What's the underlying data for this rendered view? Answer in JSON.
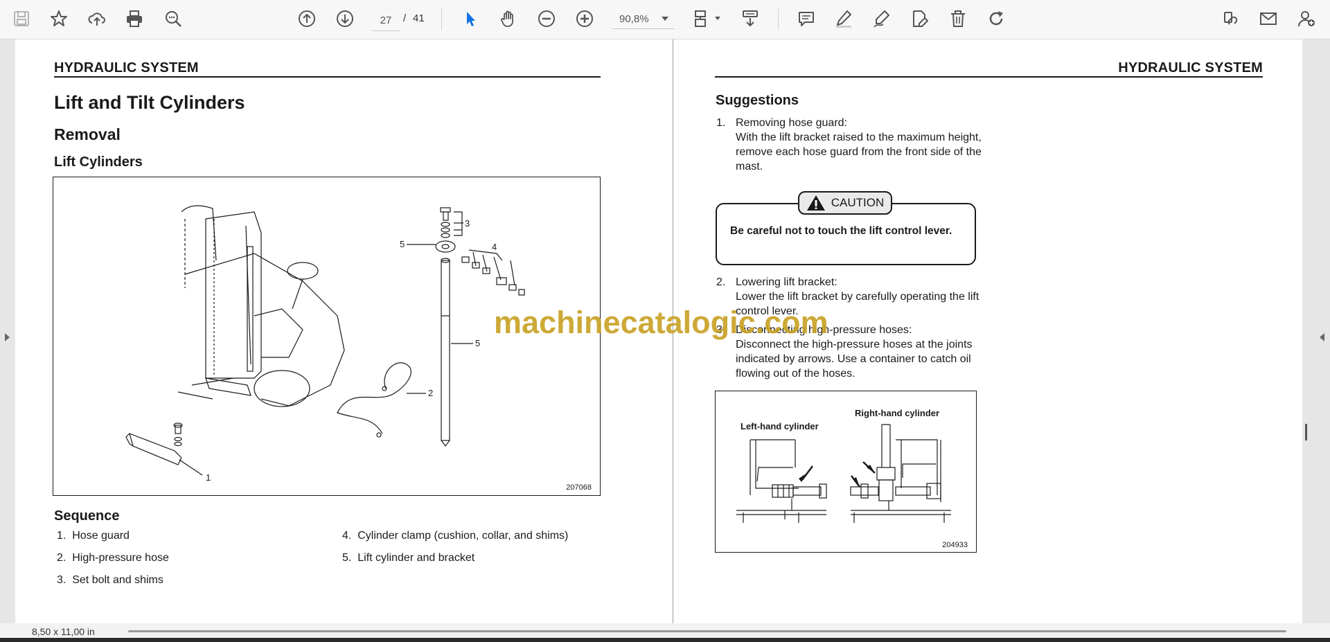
{
  "toolbar": {
    "page_current": "27",
    "page_separator": "/",
    "page_total": "41",
    "zoom_value": "90,8%"
  },
  "left_page": {
    "header": "HYDRAULIC SYSTEM",
    "title": "Lift and Tilt Cylinders",
    "subtitle": "Removal",
    "section": "Lift Cylinders",
    "figure": {
      "id": "207068",
      "callouts": [
        "1",
        "2",
        "3",
        "4",
        "5",
        "5"
      ]
    },
    "sequence_title": "Sequence",
    "sequence": [
      {
        "n": "1.",
        "text": "Hose guard"
      },
      {
        "n": "2.",
        "text": "High-pressure hose"
      },
      {
        "n": "3.",
        "text": "Set bolt and shims"
      },
      {
        "n": "4.",
        "text": "Cylinder clamp (cushion, collar, and shims)"
      },
      {
        "n": "5.",
        "text": "Lift cylinder and bracket"
      }
    ]
  },
  "right_page": {
    "header": "HYDRAULIC SYSTEM",
    "suggestions_title": "Suggestions",
    "steps": [
      {
        "n": "1.",
        "title": "Removing hose guard:",
        "text": "With the lift bracket raised to the maximum height, remove each hose guard from the front side of the mast."
      },
      {
        "n": "2.",
        "title": "Lowering lift bracket:",
        "text": "Lower the lift bracket by carefully operating the lift control lever."
      },
      {
        "n": "3.",
        "title": "Disconnecting high-pressure hoses:",
        "text": "Disconnect the high-pressure hoses at the joints indicated by arrows. Use a container to catch oil flowing out of the hoses."
      }
    ],
    "caution_label": "CAUTION",
    "caution_text": "Be careful not to touch the lift control lever.",
    "figure": {
      "id": "204933",
      "left_label": "Left-hand cylinder",
      "right_label": "Right-hand cylinder"
    }
  },
  "watermark": "machinecatalogic.com",
  "status": {
    "page_size": "8,50 x 11,00 in"
  },
  "icons": [
    "save-icon",
    "bookmark-star-icon",
    "upload-cloud-icon",
    "print-icon",
    "zoom-search-icon",
    "page-up-icon",
    "page-down-icon",
    "select-cursor-icon",
    "hand-icon",
    "zoom-out-icon",
    "zoom-in-icon",
    "page-fit-icon",
    "scroll-mode-icon",
    "comment-icon",
    "highlight-icon",
    "draw-icon",
    "edit-pdf-icon",
    "delete-icon",
    "rotate-icon",
    "share-link-icon",
    "email-icon",
    "add-user-icon"
  ],
  "colors": {
    "accent": "#1473e6",
    "watermark": "#c9a227"
  }
}
